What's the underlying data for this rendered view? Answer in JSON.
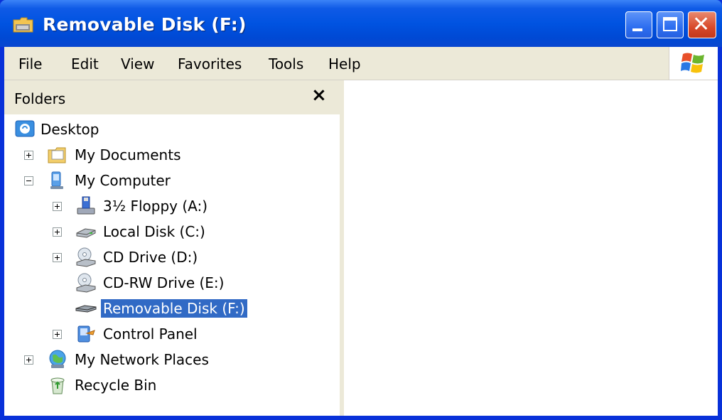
{
  "window": {
    "title": "Removable Disk (F:)"
  },
  "menubar": {
    "items": [
      "File",
      "Edit",
      "View",
      "Favorites",
      "Tools",
      "Help"
    ]
  },
  "folders_pane": {
    "title": "Folders",
    "close_glyph": "×",
    "tree": [
      {
        "label": "Desktop",
        "icon": "desktop-icon",
        "expander": "none"
      },
      {
        "label": "My Documents",
        "icon": "my-documents-icon",
        "expander": "plus"
      },
      {
        "label": "My Computer",
        "icon": "my-computer-icon",
        "expander": "minus"
      },
      {
        "label": "3½ Floppy (A:)",
        "icon": "floppy-drive-icon",
        "expander": "plus"
      },
      {
        "label": "Local Disk (C:)",
        "icon": "hard-disk-icon",
        "expander": "plus"
      },
      {
        "label": "CD Drive (D:)",
        "icon": "cd-drive-icon",
        "expander": "plus"
      },
      {
        "label": "CD-RW Drive (E:)",
        "icon": "cd-rw-drive-icon",
        "expander": "none"
      },
      {
        "label": "Removable Disk (F:)",
        "icon": "removable-disk-icon",
        "expander": "none",
        "selected": true
      },
      {
        "label": "Control Panel",
        "icon": "control-panel-icon",
        "expander": "plus"
      },
      {
        "label": "My Network Places",
        "icon": "network-places-icon",
        "expander": "plus"
      },
      {
        "label": "Recycle Bin",
        "icon": "recycle-bin-icon",
        "expander": "none"
      }
    ]
  },
  "colors": {
    "titlebar": "#0053e1",
    "selection": "#316ac5",
    "menubar": "#ece9d8"
  }
}
